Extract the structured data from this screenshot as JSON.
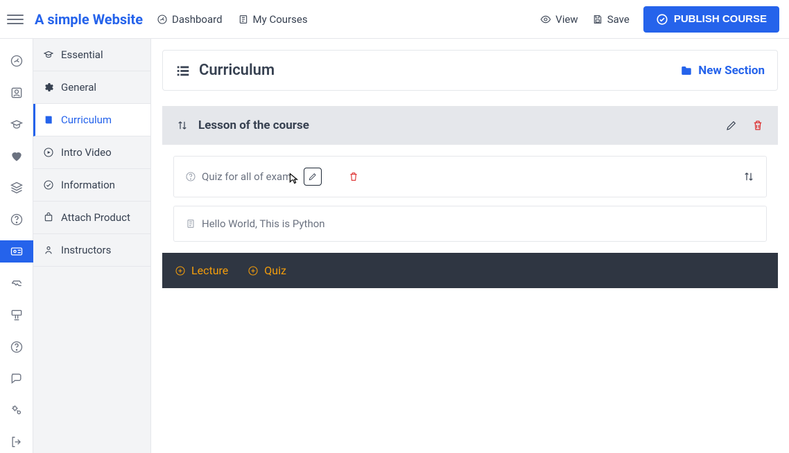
{
  "brand": "A simple Website",
  "top_links": {
    "dashboard": "Dashboard",
    "my_courses": "My Courses"
  },
  "top_actions": {
    "view": "View",
    "save": "Save",
    "publish": "PUBLISH COURSE"
  },
  "course_nav": [
    {
      "label": "Essential"
    },
    {
      "label": "General"
    },
    {
      "label": "Curriculum"
    },
    {
      "label": "Intro Video"
    },
    {
      "label": "Information"
    },
    {
      "label": "Attach Product"
    },
    {
      "label": "Instructors"
    }
  ],
  "panel": {
    "title": "Curriculum",
    "new_section": "New Section"
  },
  "section": {
    "title": "Lesson of the course",
    "items": [
      {
        "label": "Quiz for all of exam",
        "type": "quiz"
      },
      {
        "label": "Hello World, This is Python",
        "type": "lecture"
      }
    ]
  },
  "add_bar": {
    "lecture": "Lecture",
    "quiz": "Quiz"
  }
}
